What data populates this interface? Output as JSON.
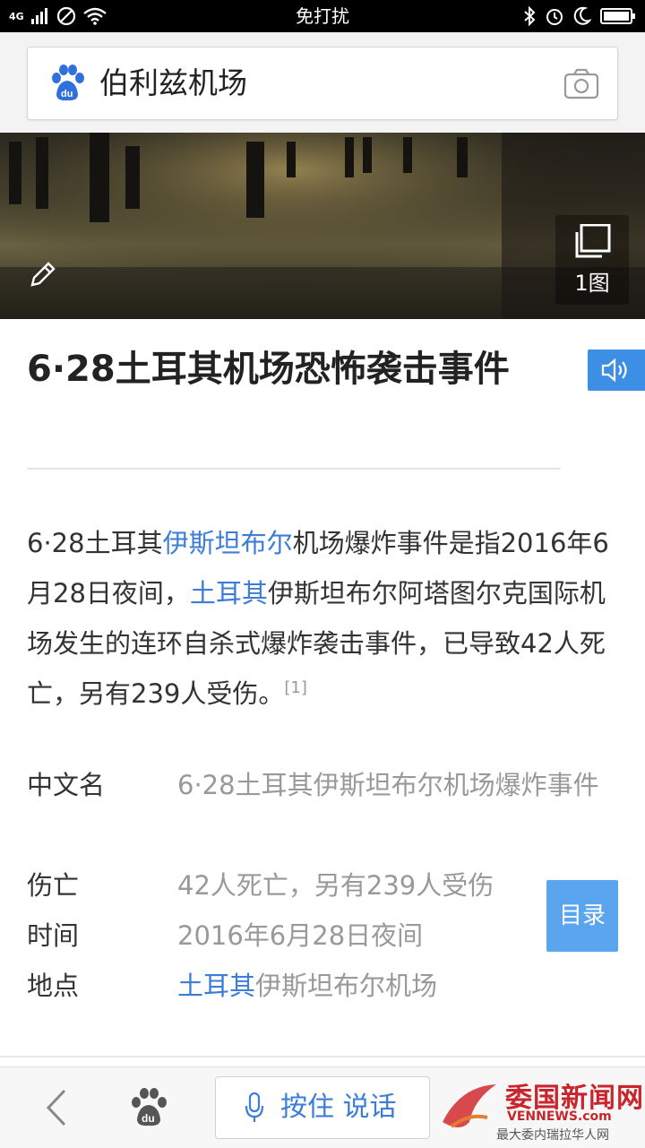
{
  "status_bar": {
    "network": "4G",
    "center_text": "免打扰"
  },
  "search": {
    "query": "伯利兹机场"
  },
  "hero": {
    "image_count": "1图"
  },
  "article": {
    "title": "6·28土耳其机场恐怖袭击事件",
    "summary_part1": "6·28土耳其",
    "summary_link1": "伊斯坦布尔",
    "summary_part2": "机场爆炸事件是指2016年6月28日夜间，",
    "summary_link2": "土耳其",
    "summary_part3": "伊斯坦布尔阿塔图尔克国际机场发生的连环自杀式爆炸袭击事件，已导致42人死亡，另有239人受伤。",
    "citation": "[1]"
  },
  "info": {
    "name_key": "中文名",
    "name_val": "6·28土耳其伊斯坦布尔机场爆炸事件",
    "casualties_key": "伤亡",
    "casualties_val": "42人死亡，另有239人受伤",
    "time_key": "时间",
    "time_val": "2016年6月28日夜间",
    "place_key": "地点",
    "place_link": "土耳其",
    "place_rest": "伊斯坦布尔机场"
  },
  "toc_button": "目录",
  "bottom": {
    "voice_label": "按住 说话"
  },
  "watermark": {
    "title": "委国新闻网",
    "site": "VENNEWS.com",
    "slogan": "最大委内瑞拉华人网"
  }
}
